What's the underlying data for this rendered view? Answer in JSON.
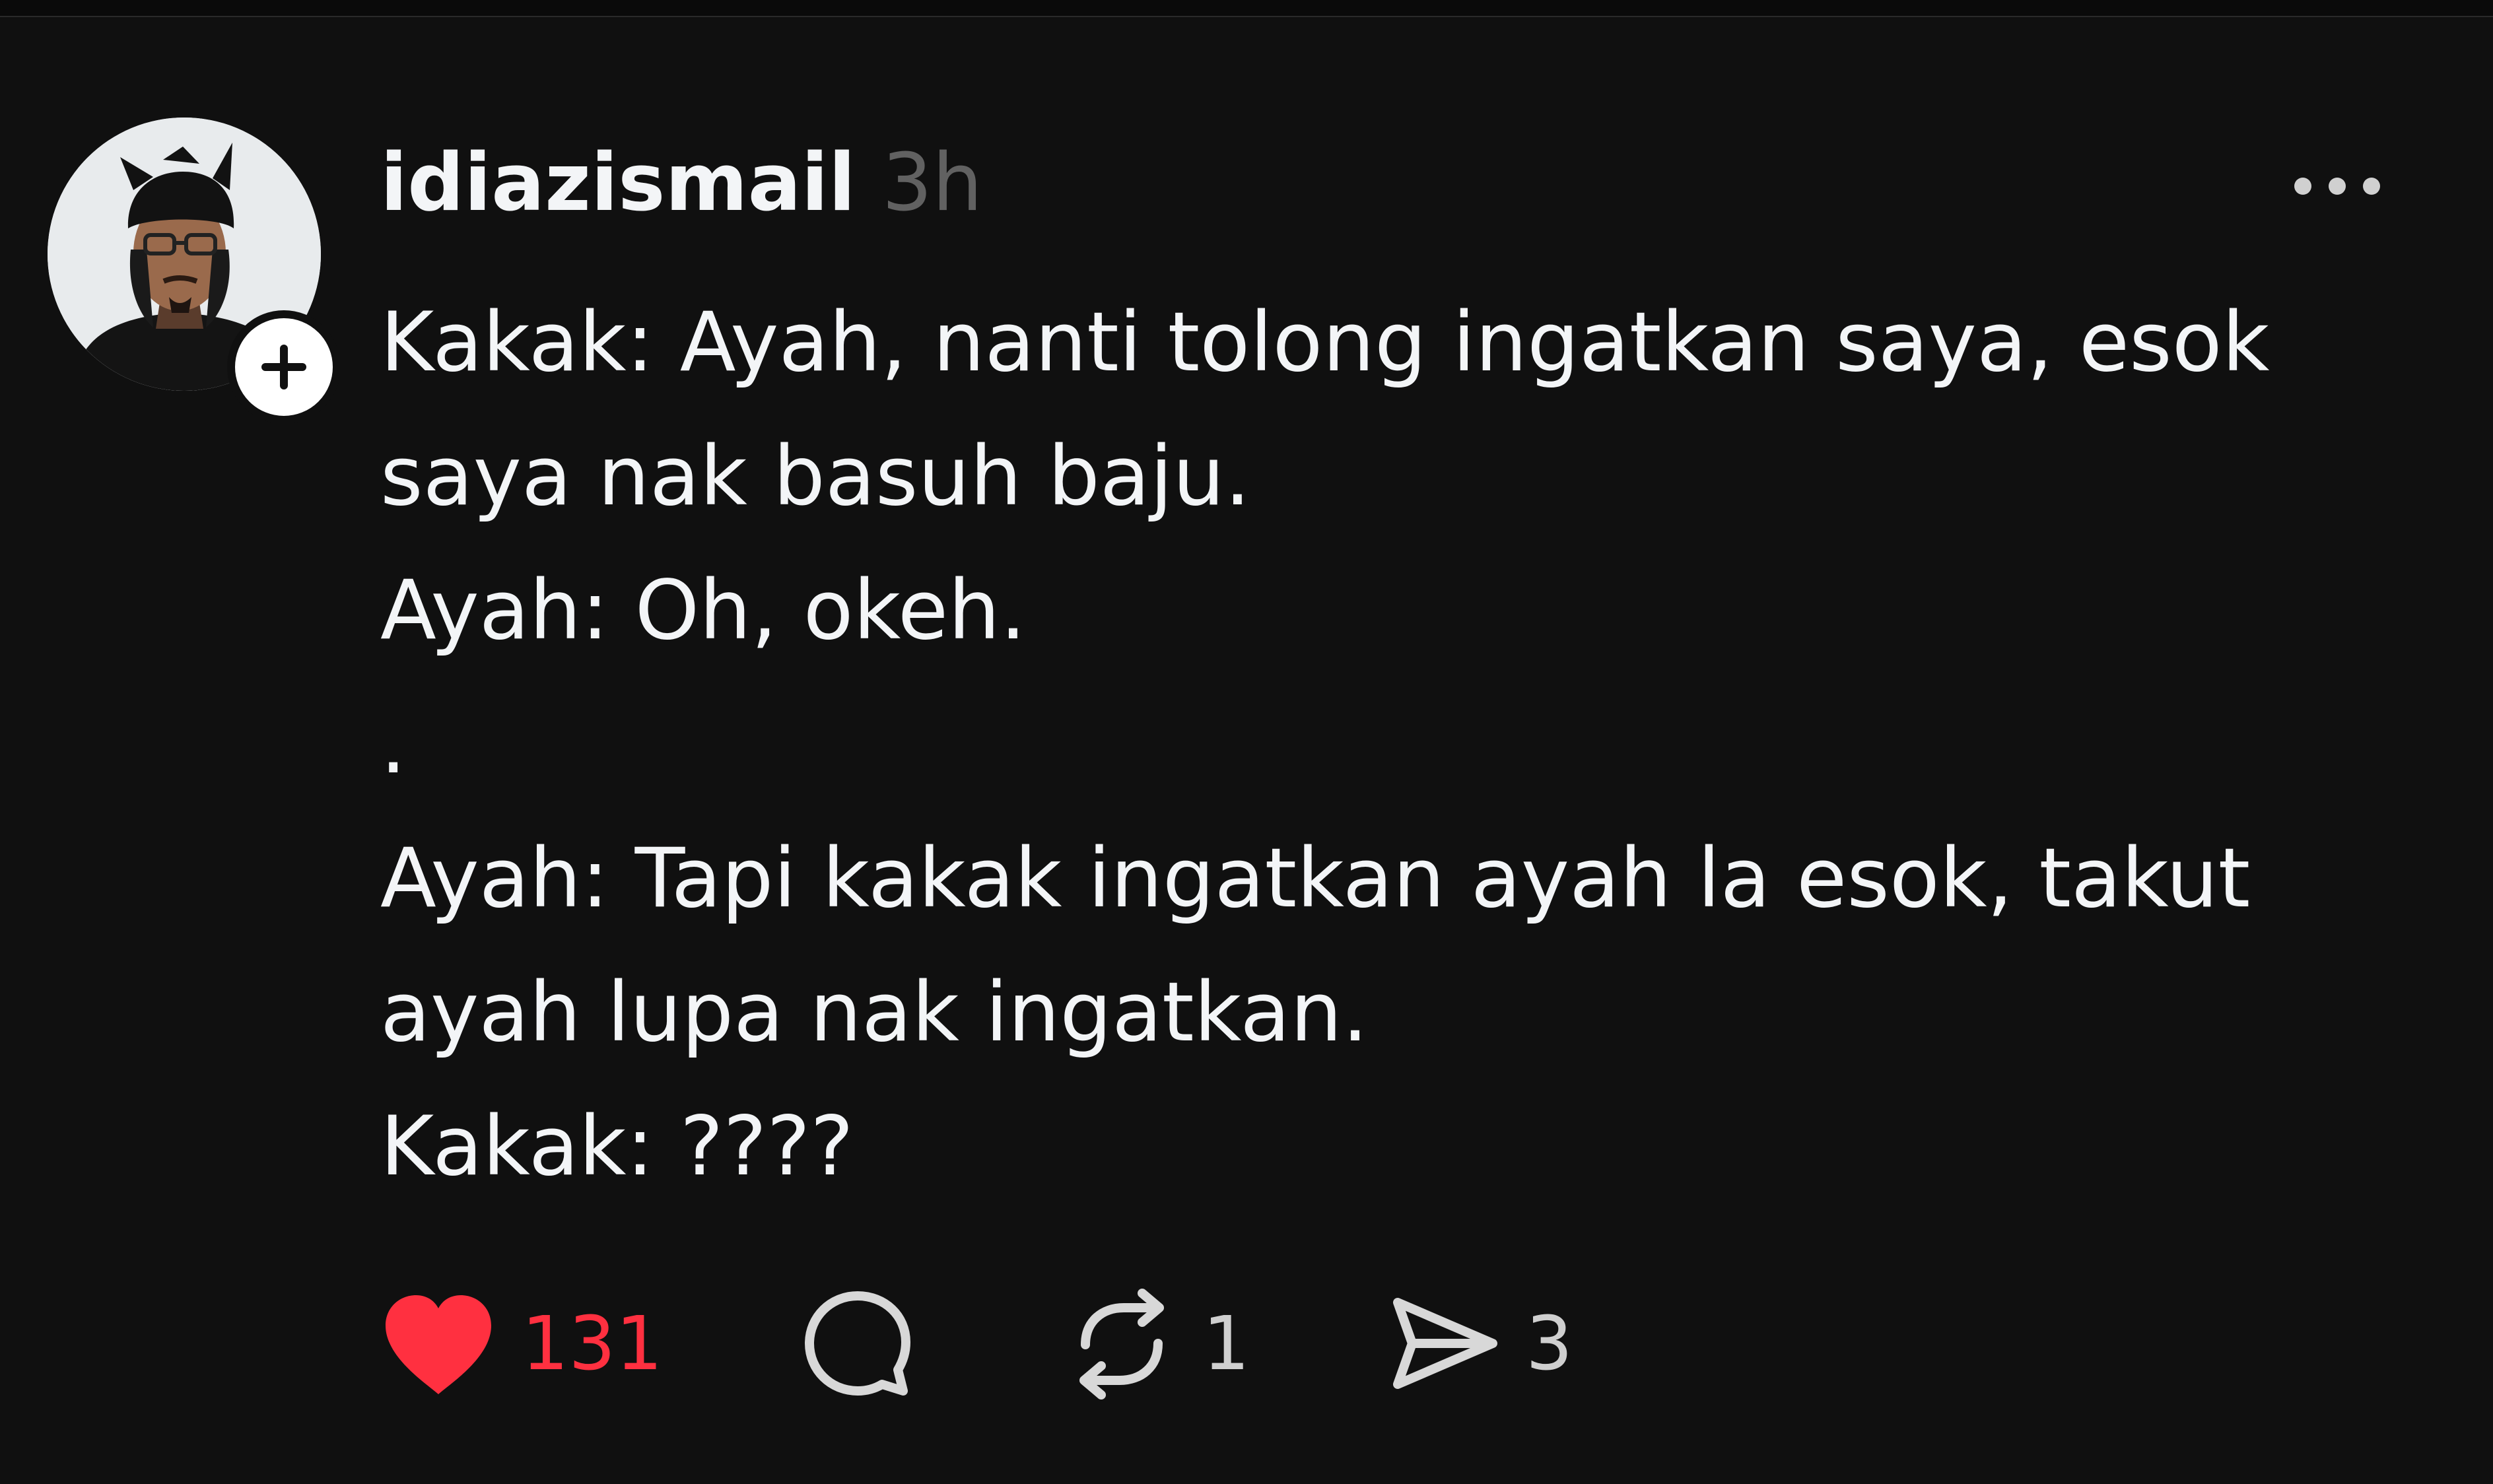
{
  "post": {
    "username": "idiazismail",
    "timestamp": "3h",
    "body_lines": [
      "Kakak: Ayah, nanti tolong ingatkan saya, esok saya nak basuh baju.",
      "Ayah: Oh, okeh.",
      ".",
      "Ayah: Tapi kakak ingatkan ayah la esok, takut ayah lupa nak ingatkan.",
      "Kakak: ????"
    ],
    "actions": {
      "likes": "131",
      "reposts": "1",
      "shares": "3"
    },
    "icons": {
      "like": "heart-icon",
      "reply": "comment-icon",
      "repost": "repost-icon",
      "share": "send-icon",
      "more": "more-icon",
      "follow": "plus-icon"
    }
  },
  "colors": {
    "background": "#101010",
    "text": "#f3f5f7",
    "muted": "#616161",
    "like": "#ff3040",
    "icon": "#d8d8d8"
  }
}
